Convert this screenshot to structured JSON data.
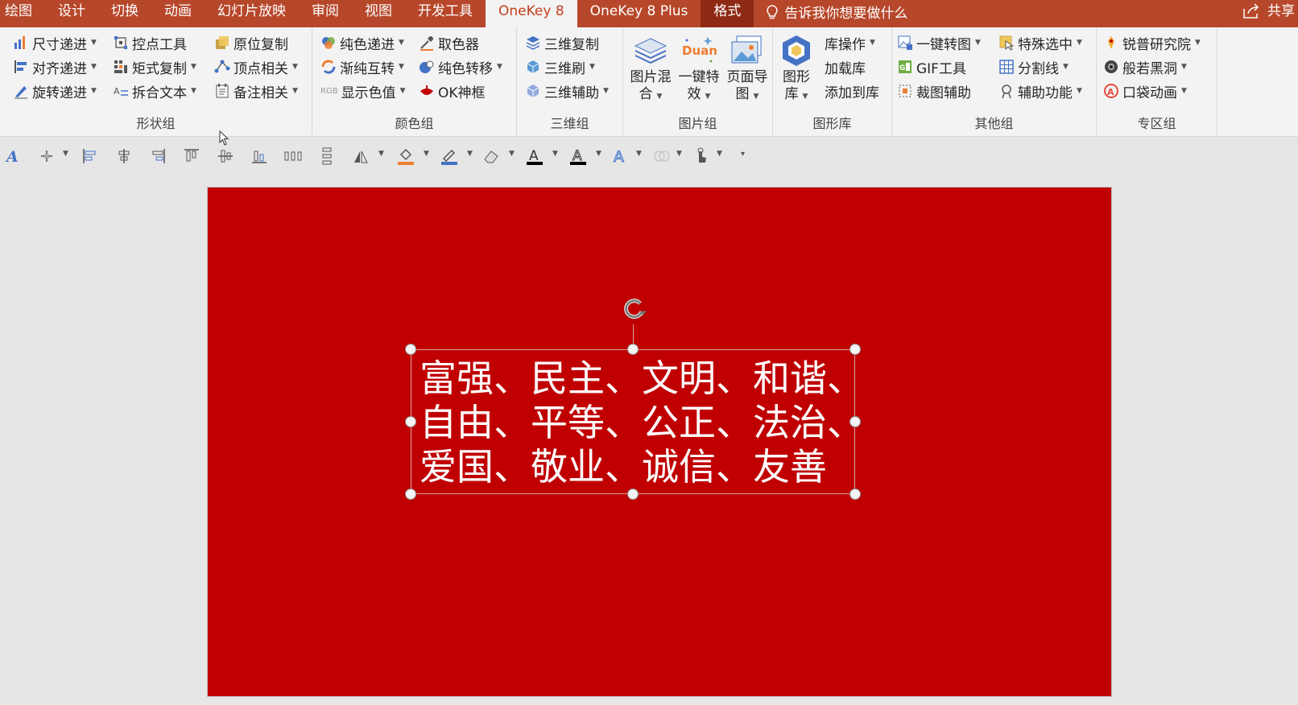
{
  "menu": {
    "tabs": [
      "绘图",
      "设计",
      "切换",
      "动画",
      "幻灯片放映",
      "审阅",
      "视图",
      "开发工具"
    ],
    "active_tab": "OneKey 8",
    "plus_tab": "OneKey 8 Plus",
    "format_tab": "格式",
    "tell_me": "告诉我你想要做什么",
    "share": "共享"
  },
  "ribbon": {
    "shape_group": {
      "label": "形状组",
      "size_step": "尺寸递进",
      "align_step": "对齐递进",
      "rotate_step": "旋转递进",
      "control_tool": "控点工具",
      "matrix_copy": "矩式复制",
      "split_text": "拆合文本",
      "inplace_copy": "原位复制",
      "vertex": "顶点相关",
      "notes": "备注相关"
    },
    "color_group": {
      "label": "颜色组",
      "pure_step": "纯色递进",
      "gradient_swap": "渐纯互转",
      "show_color": "显示色值",
      "rgb_label": "RGB",
      "picker": "取色器",
      "pure_move": "纯色转移",
      "ok_frame": "OK神框"
    },
    "threed_group": {
      "label": "三维组",
      "copy": "三维复制",
      "brush": "三维刷",
      "assist": "三维辅助"
    },
    "picture_group": {
      "label": "图片组",
      "mix_l1": "图片混",
      "mix_l2": "合",
      "duang_text": "Duang",
      "effect_l1": "一键特",
      "effect_l2": "效",
      "page_l1": "页面导",
      "page_l2": "图"
    },
    "shape_lib": {
      "label": "图形库",
      "lib_l1": "图形",
      "lib_l2": "库",
      "lib_op": "库操作",
      "load": "加载库",
      "add": "添加到库"
    },
    "other_group": {
      "label": "其他组",
      "one_key_img": "一键转图",
      "gif": "GIF工具",
      "crop": "裁图辅助",
      "special_select": "特殊选中",
      "divider": "分割线",
      "helper": "辅助功能"
    },
    "zone_group": {
      "label": "专区组",
      "ruipu": "锐普研究院",
      "boruo": "般若黑洞",
      "pocket": "口袋动画"
    }
  },
  "qat": {
    "font_color_bar": "#000000",
    "fill_bar": "#ed7d31",
    "line_bar": "#4472c4"
  },
  "slide": {
    "background": "#c00000",
    "text": "富强、民主、文明、和谐、\n自由、平等、公正、法治、\n爱国、敬业、诚信、友善"
  }
}
